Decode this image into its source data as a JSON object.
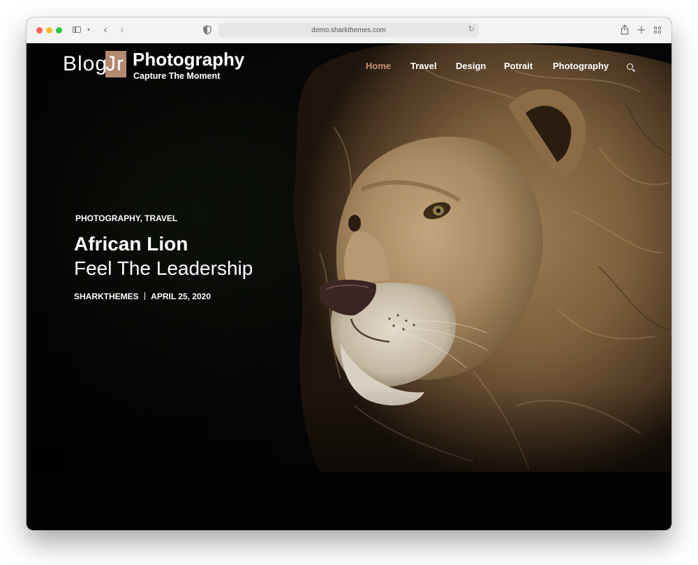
{
  "browser": {
    "url": "demo.sharkthemes.com"
  },
  "site": {
    "logo_blog": "Blog",
    "logo_jr": "Jr",
    "title": "Photography",
    "tagline": "Capture The Moment"
  },
  "nav": {
    "items": [
      "Home",
      "Travel",
      "Design",
      "Potrait",
      "Photography"
    ],
    "active_color": "#c7936f"
  },
  "post": {
    "categories": [
      "PHOTOGRAPHY",
      "TRAVEL"
    ],
    "category_separator": ",",
    "title": "African Lion",
    "subtitle": "Feel The Leadership",
    "author": "SHARKTHEMES",
    "date": "APRIL 25, 2020"
  },
  "colors": {
    "accent": "#b58a73",
    "background": "#000000"
  }
}
